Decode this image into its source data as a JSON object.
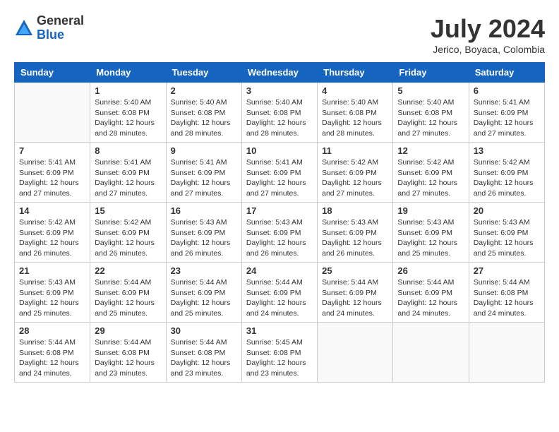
{
  "logo": {
    "general": "General",
    "blue": "Blue"
  },
  "title": {
    "month_year": "July 2024",
    "location": "Jerico, Boyaca, Colombia"
  },
  "weekdays": [
    "Sunday",
    "Monday",
    "Tuesday",
    "Wednesday",
    "Thursday",
    "Friday",
    "Saturday"
  ],
  "weeks": [
    [
      {
        "day": "",
        "info": ""
      },
      {
        "day": "1",
        "info": "Sunrise: 5:40 AM\nSunset: 6:08 PM\nDaylight: 12 hours\nand 28 minutes."
      },
      {
        "day": "2",
        "info": "Sunrise: 5:40 AM\nSunset: 6:08 PM\nDaylight: 12 hours\nand 28 minutes."
      },
      {
        "day": "3",
        "info": "Sunrise: 5:40 AM\nSunset: 6:08 PM\nDaylight: 12 hours\nand 28 minutes."
      },
      {
        "day": "4",
        "info": "Sunrise: 5:40 AM\nSunset: 6:08 PM\nDaylight: 12 hours\nand 28 minutes."
      },
      {
        "day": "5",
        "info": "Sunrise: 5:40 AM\nSunset: 6:08 PM\nDaylight: 12 hours\nand 27 minutes."
      },
      {
        "day": "6",
        "info": "Sunrise: 5:41 AM\nSunset: 6:09 PM\nDaylight: 12 hours\nand 27 minutes."
      }
    ],
    [
      {
        "day": "7",
        "info": "Sunrise: 5:41 AM\nSunset: 6:09 PM\nDaylight: 12 hours\nand 27 minutes."
      },
      {
        "day": "8",
        "info": "Sunrise: 5:41 AM\nSunset: 6:09 PM\nDaylight: 12 hours\nand 27 minutes."
      },
      {
        "day": "9",
        "info": "Sunrise: 5:41 AM\nSunset: 6:09 PM\nDaylight: 12 hours\nand 27 minutes."
      },
      {
        "day": "10",
        "info": "Sunrise: 5:41 AM\nSunset: 6:09 PM\nDaylight: 12 hours\nand 27 minutes."
      },
      {
        "day": "11",
        "info": "Sunrise: 5:42 AM\nSunset: 6:09 PM\nDaylight: 12 hours\nand 27 minutes."
      },
      {
        "day": "12",
        "info": "Sunrise: 5:42 AM\nSunset: 6:09 PM\nDaylight: 12 hours\nand 27 minutes."
      },
      {
        "day": "13",
        "info": "Sunrise: 5:42 AM\nSunset: 6:09 PM\nDaylight: 12 hours\nand 26 minutes."
      }
    ],
    [
      {
        "day": "14",
        "info": "Sunrise: 5:42 AM\nSunset: 6:09 PM\nDaylight: 12 hours\nand 26 minutes."
      },
      {
        "day": "15",
        "info": "Sunrise: 5:42 AM\nSunset: 6:09 PM\nDaylight: 12 hours\nand 26 minutes."
      },
      {
        "day": "16",
        "info": "Sunrise: 5:43 AM\nSunset: 6:09 PM\nDaylight: 12 hours\nand 26 minutes."
      },
      {
        "day": "17",
        "info": "Sunrise: 5:43 AM\nSunset: 6:09 PM\nDaylight: 12 hours\nand 26 minutes."
      },
      {
        "day": "18",
        "info": "Sunrise: 5:43 AM\nSunset: 6:09 PM\nDaylight: 12 hours\nand 26 minutes."
      },
      {
        "day": "19",
        "info": "Sunrise: 5:43 AM\nSunset: 6:09 PM\nDaylight: 12 hours\nand 25 minutes."
      },
      {
        "day": "20",
        "info": "Sunrise: 5:43 AM\nSunset: 6:09 PM\nDaylight: 12 hours\nand 25 minutes."
      }
    ],
    [
      {
        "day": "21",
        "info": "Sunrise: 5:43 AM\nSunset: 6:09 PM\nDaylight: 12 hours\nand 25 minutes."
      },
      {
        "day": "22",
        "info": "Sunrise: 5:44 AM\nSunset: 6:09 PM\nDaylight: 12 hours\nand 25 minutes."
      },
      {
        "day": "23",
        "info": "Sunrise: 5:44 AM\nSunset: 6:09 PM\nDaylight: 12 hours\nand 25 minutes."
      },
      {
        "day": "24",
        "info": "Sunrise: 5:44 AM\nSunset: 6:09 PM\nDaylight: 12 hours\nand 24 minutes."
      },
      {
        "day": "25",
        "info": "Sunrise: 5:44 AM\nSunset: 6:09 PM\nDaylight: 12 hours\nand 24 minutes."
      },
      {
        "day": "26",
        "info": "Sunrise: 5:44 AM\nSunset: 6:09 PM\nDaylight: 12 hours\nand 24 minutes."
      },
      {
        "day": "27",
        "info": "Sunrise: 5:44 AM\nSunset: 6:08 PM\nDaylight: 12 hours\nand 24 minutes."
      }
    ],
    [
      {
        "day": "28",
        "info": "Sunrise: 5:44 AM\nSunset: 6:08 PM\nDaylight: 12 hours\nand 24 minutes."
      },
      {
        "day": "29",
        "info": "Sunrise: 5:44 AM\nSunset: 6:08 PM\nDaylight: 12 hours\nand 23 minutes."
      },
      {
        "day": "30",
        "info": "Sunrise: 5:44 AM\nSunset: 6:08 PM\nDaylight: 12 hours\nand 23 minutes."
      },
      {
        "day": "31",
        "info": "Sunrise: 5:45 AM\nSunset: 6:08 PM\nDaylight: 12 hours\nand 23 minutes."
      },
      {
        "day": "",
        "info": ""
      },
      {
        "day": "",
        "info": ""
      },
      {
        "day": "",
        "info": ""
      }
    ]
  ]
}
